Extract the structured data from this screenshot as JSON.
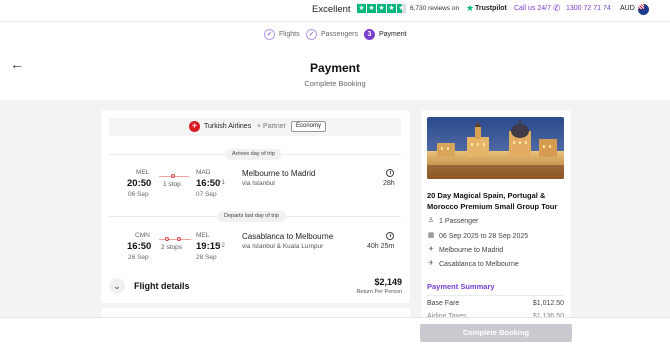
{
  "topbar": {
    "rating_word": "Excellent",
    "reviews_text": "6,730 reviews on",
    "trustpilot_label": "Trustpilot",
    "call_label": "Call us 24/7",
    "phone": "1300 72 71 74",
    "currency": "AUD",
    "colors": {
      "trustpilot_green": "#00b67a",
      "accent": "#7a3fcf"
    }
  },
  "steps": [
    {
      "num": "✓",
      "label": "Flights",
      "state": "done"
    },
    {
      "num": "✓",
      "label": "Passengers",
      "state": "done"
    },
    {
      "num": "3",
      "label": "Payment",
      "state": "active"
    }
  ],
  "header": {
    "title": "Payment",
    "subtitle": "Complete Booking"
  },
  "flight": {
    "airline": "Turkish Airlines",
    "partner": "+ Partner",
    "cabin": "Economy",
    "outbound": {
      "badge": "Arrives day of trip",
      "dep_code": "MEL",
      "dep_time": "20:50",
      "dep_date": "06 Sep",
      "arr_code": "MAD",
      "arr_time": "16:50",
      "arr_offset": "+1",
      "arr_date": "07 Sep",
      "stops": "1 stop",
      "route": "Melbourne to Madrid",
      "via": "via Istanbul",
      "duration": "28h"
    },
    "inbound": {
      "badge": "Departs last day of trip",
      "dep_code": "CMN",
      "dep_time": "16:50",
      "dep_date": "26 Sep",
      "arr_code": "MEL",
      "arr_time": "19:15",
      "arr_offset": "+2",
      "arr_date": "28 Sep",
      "stops": "2 stops",
      "route": "Casablanca to Melbourne",
      "via": "via Istanbul & Kuala Lumpur",
      "duration": "40h 25m"
    },
    "details_label": "Flight details",
    "price": "$2,149",
    "price_sub": "Return Per Person"
  },
  "summary": {
    "trip_title": "20 Day Magical Spain, Portugal & Morocco Premium Small Group Tour",
    "passengers": "1 Passenger",
    "dates": "06 Sep 2025 to 28 Sep 2025",
    "out_route": "Melbourne to Madrid",
    "in_route": "Casablanca to Melbourne",
    "payment_summary_label": "Payment Summary",
    "base_fare_label": "Base Fare",
    "base_fare_value": "$1,012.50",
    "taxes_label": "Airline Taxes",
    "taxes_value": "$1,136.50"
  },
  "footer": {
    "complete_button": "Complete Booking"
  }
}
